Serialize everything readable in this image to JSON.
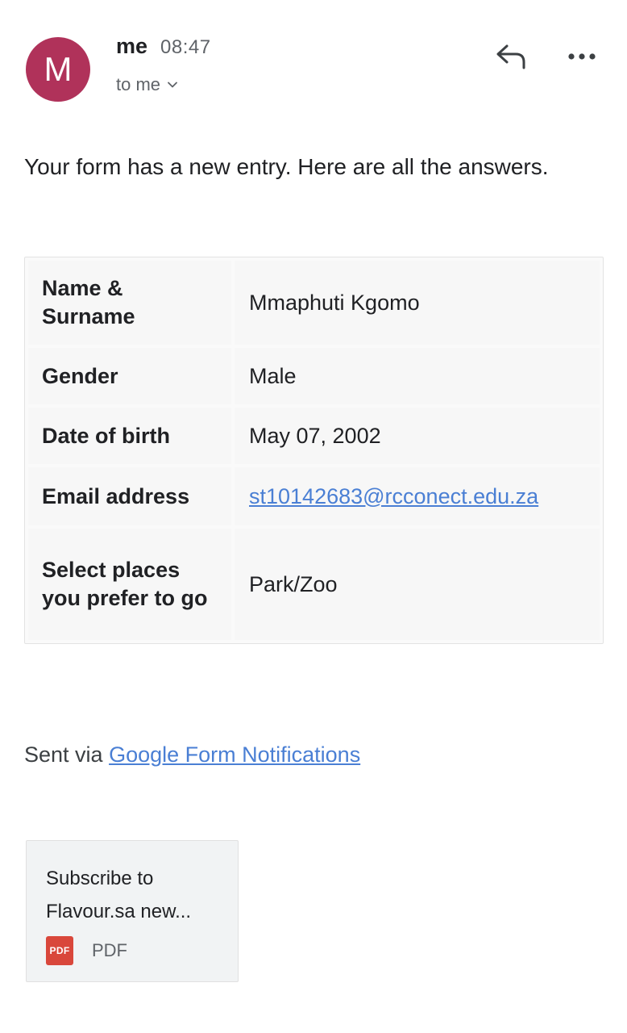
{
  "header": {
    "avatar_initial": "M",
    "sender_name": "me",
    "sent_time": "08:47",
    "recipient": "to me",
    "actions": {
      "reply_icon": "reply-icon",
      "more_icon": "more-options-icon"
    }
  },
  "message": {
    "intro": "Your form has a new entry. Here are all the answers.",
    "answers": [
      {
        "question": "Name & Surname",
        "answer": "Mmaphuti Kgomo"
      },
      {
        "question": "Gender",
        "answer": "Male"
      },
      {
        "question": "Date of birth",
        "answer": "May 07, 2002"
      },
      {
        "question": "Email address",
        "answer": "st10142683@rcconect.edu.za"
      },
      {
        "question": "Select places you prefer to go",
        "answer": "Park/Zoo"
      }
    ],
    "footer_prefix": "Sent via",
    "footer_link": "Google Form Notifications"
  },
  "attachment": {
    "name": "Subscribe to Flavour.sa new...",
    "type_badge": "PDF",
    "type_label": "PDF"
  },
  "colors": {
    "avatar": "#b0325a",
    "link": "#4a7fd4",
    "pdf_badge": "#d9473b"
  }
}
